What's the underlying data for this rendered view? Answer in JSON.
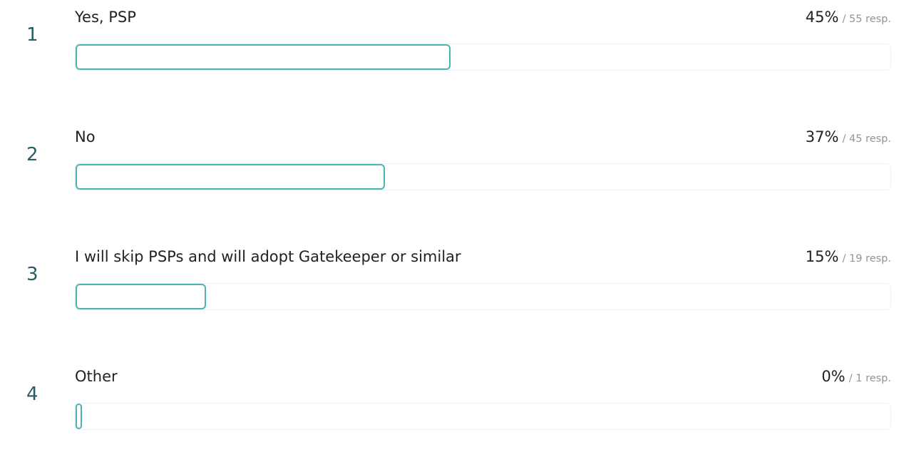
{
  "chart_data": {
    "type": "bar",
    "categories": [
      "Yes, PSP",
      "No",
      "I will skip PSPs and will adopt Gatekeeper or similar",
      "Other"
    ],
    "series": [
      {
        "values": [
          45,
          37,
          15,
          0
        ]
      },
      {
        "values": [
          55,
          45,
          19,
          1
        ]
      }
    ],
    "ylim": [
      0,
      100
    ]
  },
  "options": [
    {
      "index": "1",
      "label": "Yes, PSP",
      "percent": "45%",
      "responses": "/ 55 resp.",
      "fill_fraction": 0.46
    },
    {
      "index": "2",
      "label": "No",
      "percent": "37%",
      "responses": "/ 45 resp.",
      "fill_fraction": 0.38
    },
    {
      "index": "3",
      "label": "I will skip PSPs and will adopt Gatekeeper or similar",
      "percent": "15%",
      "responses": "/ 19 resp.",
      "fill_fraction": 0.16
    },
    {
      "index": "4",
      "label": "Other",
      "percent": "0%",
      "responses": "/ 1 resp.",
      "fill_fraction": 0.0
    }
  ],
  "colors": {
    "bar_outline": "#4bb3b3",
    "track_outline": "#eaf3f3",
    "index_text": "#2b5c63",
    "muted_text": "#8e959b"
  }
}
